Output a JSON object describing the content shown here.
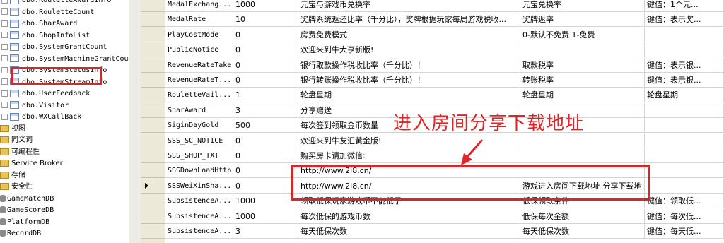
{
  "tree": {
    "items": [
      {
        "label": "dbo.RouletteAwardInfo",
        "kind": "table"
      },
      {
        "label": "dbo.RouletteCount",
        "kind": "table"
      },
      {
        "label": "dbo.SharAward",
        "kind": "table"
      },
      {
        "label": "dbo.ShopInfoList",
        "kind": "table"
      },
      {
        "label": "dbo.SystemGrantCount",
        "kind": "table"
      },
      {
        "label": "dbo.SystemMachineGrantCount",
        "kind": "table"
      },
      {
        "label": "dbo.SystemStatusInfo",
        "kind": "table",
        "selected": true
      },
      {
        "label": "dbo.SystemStreamInfo",
        "kind": "table"
      },
      {
        "label": "dbo.UserFeedback",
        "kind": "table"
      },
      {
        "label": "dbo.Visitor",
        "kind": "table"
      },
      {
        "label": "dbo.WXCallBack",
        "kind": "table"
      },
      {
        "label": "视图",
        "kind": "folder"
      },
      {
        "label": "同义词",
        "kind": "folder"
      },
      {
        "label": "可编程性",
        "kind": "folder"
      },
      {
        "label": "Service Broker",
        "kind": "folder"
      },
      {
        "label": "存储",
        "kind": "folder"
      },
      {
        "label": "安全性",
        "kind": "folder"
      },
      {
        "label": "GameMatchDB",
        "kind": "db"
      },
      {
        "label": "GameScoreDB",
        "kind": "db"
      },
      {
        "label": "PlatformDB",
        "kind": "db"
      },
      {
        "label": "RecordDB",
        "kind": "db"
      }
    ]
  },
  "grid": {
    "rows": [
      {
        "name": "MedalExchang...",
        "value": "1000",
        "desc": "元宝与游戏币兑换率",
        "title": "元宝兑换率",
        "note": "键值：1个元..."
      },
      {
        "name": "MedalRate",
        "value": "10",
        "desc": "奖牌系统返还比率（千分比），奖牌根据玩家每局游戏税收...",
        "title": "奖牌返率",
        "note": "键值：表示奖..."
      },
      {
        "name": "PlayCostMode",
        "value": "0",
        "desc": "房费免费模式",
        "title": "0-默认不免费 1-免费",
        "note": ""
      },
      {
        "name": "PublicNotice",
        "value": "0",
        "desc": "欢迎来到牛大亨新版!",
        "title": "",
        "note": ""
      },
      {
        "name": "RevenueRateTake",
        "value": "0",
        "desc": "银行取款操作税收比率（千分比）！",
        "title": "取款税率",
        "note": "键值：表示银..."
      },
      {
        "name": "RevenueRateT...",
        "value": "0",
        "desc": "银行转账操作税收比率（千分比）！",
        "title": "转账税率",
        "note": "键值：表示银..."
      },
      {
        "name": "RouletteVail...",
        "value": "1",
        "desc": "轮盘星期",
        "title": "轮盘星期",
        "note": "轮盘星期"
      },
      {
        "name": "SharAward",
        "value": "3",
        "desc": "分享赠送",
        "title": "",
        "note": ""
      },
      {
        "name": "SiginDayGold",
        "value": "500",
        "desc": "每次签到领取金币数量",
        "title": "",
        "note": ""
      },
      {
        "name": "SSS_SC_NOTICE",
        "value": "0",
        "desc": "欢迎来到牛友汇黄金版!",
        "title": "",
        "note": ""
      },
      {
        "name": "SSS_SHOP_TXT",
        "value": "0",
        "desc": "购买房卡请加微信:",
        "title": "",
        "note": ""
      },
      {
        "name": "SSSDownLoadHttp",
        "value": "0",
        "desc": "http://www.2i8.cn/",
        "title": "",
        "note": ""
      },
      {
        "name": "SSSWeiXinSha...",
        "value": "0",
        "desc": "http://www.2i8.cn/",
        "title": "游戏进入房间下载地址 分享下载地",
        "note": "",
        "current": true
      },
      {
        "name": "SubsistenceA...",
        "value": "1000",
        "desc": "领取低保玩家游戏币不能低于",
        "title": "低保领取条件",
        "note": "键值：领取低..."
      },
      {
        "name": "SubsistenceA...",
        "value": "1000",
        "desc": "每次低保的游戏币数",
        "title": "低保每次金额",
        "note": "键值：每次低..."
      },
      {
        "name": "SubsistenceA...",
        "value": "3",
        "desc": "每天低保次数",
        "title": "每天低保次数",
        "note": "键值：每天低..."
      }
    ]
  },
  "annotation": {
    "text": "进入房间分享下载地址"
  },
  "colors": {
    "highlight": "#e02424"
  }
}
